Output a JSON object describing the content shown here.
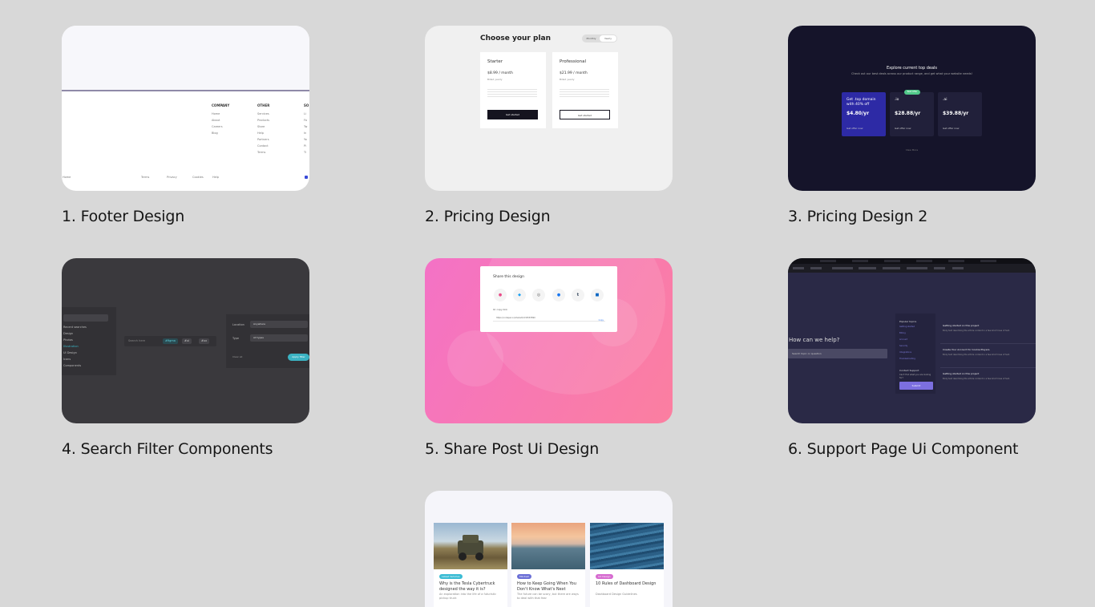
{
  "cards": [
    {
      "caption": "1. Footer Design",
      "thumb": {
        "columns": [
          {
            "heading": "COMPANY",
            "items": [
              "Home",
              "About",
              "Careers",
              "Blog"
            ]
          },
          {
            "heading": "OTHER",
            "items": [
              "Services",
              "Products",
              "Store",
              "Help",
              "Partners",
              "Contact",
              "Terms"
            ]
          },
          {
            "heading": "SO",
            "items": [
              "Li",
              "Fa",
              "Tw",
              "In",
              "Yo",
              "Pi",
              "Ti"
            ]
          }
        ],
        "bottom_links": [
          "Home",
          "Terms",
          "Privacy",
          "Cookies",
          "Help"
        ]
      }
    },
    {
      "caption": "2. Pricing Design",
      "thumb": {
        "title": "Choose your plan",
        "toggle": [
          "Monthly",
          "Yearly"
        ],
        "plans": [
          {
            "name": "Starter",
            "price": "$8.99 / month",
            "billing": "Billed yearly",
            "button": "Get started"
          },
          {
            "name": "Professional",
            "price": "$21.99 / month",
            "billing": "Billed yearly",
            "button": "Get started"
          }
        ]
      }
    },
    {
      "caption": "3. Pricing Design 2",
      "thumb": {
        "title": "Explore current top deals",
        "subtitle": "Check out our best deals across our product range, and get what your website needs!",
        "badge": "Best Offer",
        "deals": [
          {
            "headline": "Get .top domain with 40% off",
            "price": "$4.80/yr",
            "footer": "Get offer now"
          },
          {
            "headline": ".io",
            "price": "$28.88/yr",
            "footer": "Get offer now"
          },
          {
            "headline": ".ai",
            "price": "$39.88/yr",
            "footer": "Get offer now"
          }
        ],
        "more": "View More"
      }
    },
    {
      "caption": "4. Search Filter Components",
      "thumb": {
        "left_items": [
          "Recent searches",
          "Design",
          "Photos",
          "Illustration",
          "UI Design",
          "Icons",
          "Components"
        ],
        "search_placeholder": "Search here",
        "chips": [
          "#figma",
          "#ui",
          "#ux"
        ],
        "filters": [
          {
            "label": "Location",
            "value": "Anywhere"
          },
          {
            "label": "Type",
            "value": "All types"
          }
        ],
        "clear": "Clear all",
        "apply": "Apply filter"
      }
    },
    {
      "caption": "5. Share Post Ui Design",
      "thumb": {
        "title": "Share this design",
        "url_label": "Or copy link",
        "url": "https://codepen.io/shared/1234567890",
        "copy": "Copy",
        "icons": [
          "dribbble-icon",
          "twitter-icon",
          "web-icon",
          "facebook-icon",
          "tumblr-icon",
          "linkedin-icon"
        ]
      }
    },
    {
      "caption": "6. Support Page Ui Component",
      "thumb": {
        "question": "How can we help?",
        "search_placeholder": "Search topic or question",
        "side_heading": "Popular topics",
        "topics": [
          "Getting started",
          "Billing",
          "Account",
          "Security",
          "Integrations",
          "Troubleshooting"
        ],
        "contact_heading": "Contact Support",
        "contact_text": "Can't find what you are looking for?",
        "contact_button": "Submit",
        "articles": [
          {
            "title": "Getting started on this project",
            "text": "Body text describing the article content in a few short lines of text."
          },
          {
            "title": "Create Your Account for Cookie Players",
            "text": "Body text describing the article content in a few short lines of text."
          },
          {
            "title": "Getting started on this project",
            "text": "Body text describing the article content in a few short lines of text."
          }
        ]
      }
    },
    {
      "caption": "",
      "thumb": {
        "posts": [
          {
            "tag": "Latest Vehicles",
            "tag_color": "#3bbcd4",
            "title": "Why is the Tesla Cybertruck designed the way it is?",
            "summary": "An exploration into the life of a futuristic pickup truck"
          },
          {
            "tag": "Mindset",
            "tag_color": "#6b6fd6",
            "title": "How to Keep Going When You Don't Know What's Next",
            "summary": "The future can be scary, but there are ways to deal with that fear"
          },
          {
            "tag": "UX Design",
            "tag_color": "#d66bd0",
            "title": "10 Rules of Dashboard Design",
            "summary": "Dashboard Design Guidelines"
          }
        ]
      }
    }
  ]
}
